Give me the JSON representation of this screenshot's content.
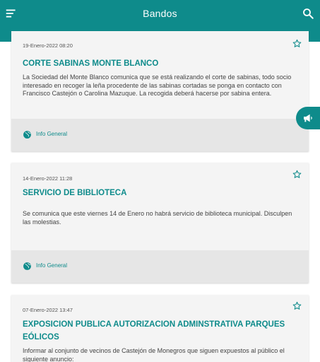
{
  "header": {
    "title": "Bandos"
  },
  "icons": {
    "menu": "menu-icon",
    "search": "search-icon",
    "star": "star-outline-icon",
    "globe": "globe-icon",
    "megaphone": "megaphone-icon"
  },
  "colors": {
    "primary": "#0e8b8b",
    "card": "#f4f4f4",
    "footer": "#e6e6e6"
  },
  "bandos": [
    {
      "date": "19-Enero-2022 08:20",
      "title": "CORTE SABINAS MONTE BLANCO",
      "body": "La Sociedad del Monte Blanco comunica que se está realizando el corte de sabinas, todo socio interesado en recoger la leña procedente de las sabinas cortadas se ponga en contacto con Francisco Castejón o Carolina Mazuque. La recogida deberá hacerse por sabina entera.",
      "category": "Info General"
    },
    {
      "date": "14-Enero-2022 11:28",
      "title": "SERVICIO DE BIBLIOTECA",
      "body": "Se comunica que este viernes 14 de Enero no habrá servicio de biblioteca municipal. Disculpen las molestias.",
      "category": "Info General"
    },
    {
      "date": "07-Enero-2022 13:47",
      "title": "EXPOSICION PUBLICA  AUTORIZACION ADMINSTRATIVA PARQUES EÓLICOS",
      "body": "Informar al conjunto de vecinos de Castejón de Monegros que siguen expuestos al público el siguiente anuncio:",
      "category": "Info General"
    }
  ]
}
